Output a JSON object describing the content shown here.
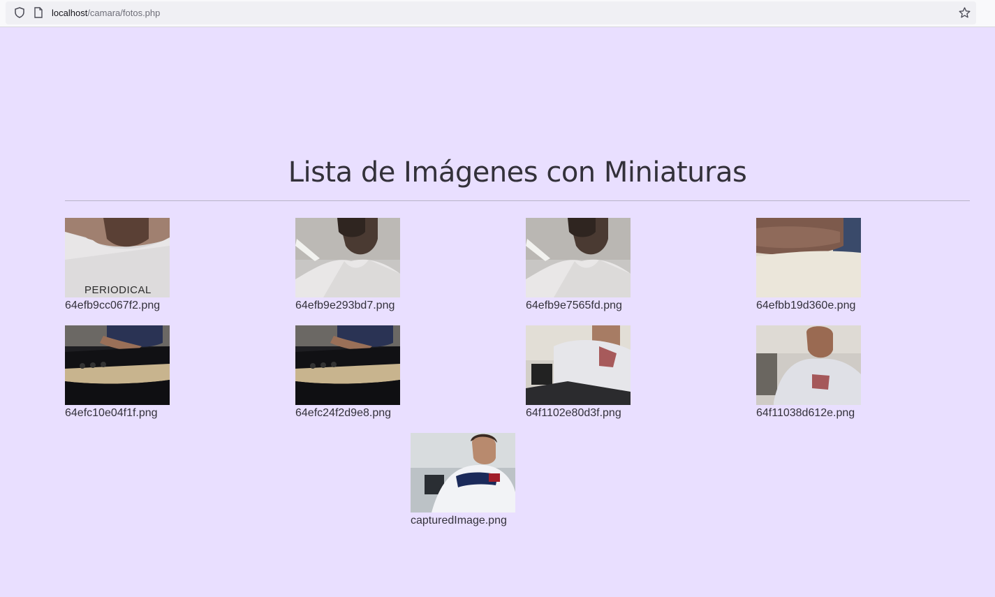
{
  "browser": {
    "url_host": "localhost",
    "url_path": "/camara/fotos.php"
  },
  "page": {
    "title": "Lista de Imágenes con Miniaturas"
  },
  "images": [
    {
      "filename": "64efb9cc067f2.png",
      "shirt_text": "PERIODICAL"
    },
    {
      "filename": "64efb9e293bd7.png"
    },
    {
      "filename": "64efb9e7565fd.png"
    },
    {
      "filename": "64efbb19d360e.png"
    },
    {
      "filename": "64efc10e04f1f.png"
    },
    {
      "filename": "64efc24f2d9e8.png"
    },
    {
      "filename": "64f1102e80d3f.png"
    },
    {
      "filename": "64f11038d612e.png"
    },
    {
      "filename": "capturedImage.png"
    }
  ],
  "colors": {
    "background": "#e9dfff",
    "text": "#33313a",
    "divider": "#b8b2c8"
  }
}
